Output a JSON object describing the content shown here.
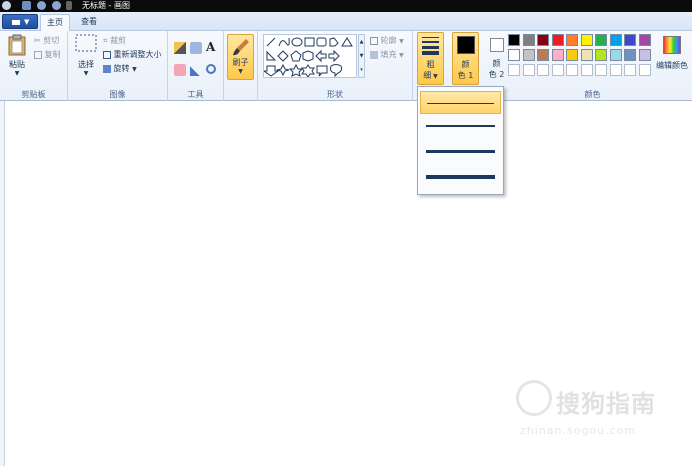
{
  "window": {
    "title": "无标题 - 画图"
  },
  "tabs": [
    {
      "label": "主页",
      "active": true
    },
    {
      "label": "查看",
      "active": false
    }
  ],
  "groups": {
    "clipboard": {
      "name": "剪贴板",
      "paste": "粘贴",
      "cut": "剪切",
      "copy": "复制"
    },
    "image": {
      "name": "图像",
      "select": "选择",
      "crop": "裁剪",
      "resize": "重新调整大小",
      "rotate": "旋转"
    },
    "tools": {
      "name": "工具"
    },
    "brush": {
      "label": "刷子"
    },
    "shapes": {
      "name": "形状",
      "outline": "轮廓",
      "fill": "填充"
    },
    "size": {
      "label_line1": "粗",
      "label_line2": "细"
    },
    "colors": {
      "name": "颜色",
      "color1_line1": "颜",
      "color1_line2": "色 1",
      "color2_line1": "颜",
      "color2_line2": "色 2",
      "edit": "编辑颜色",
      "palette_row1": [
        "#000000",
        "#7f7f7f",
        "#880015",
        "#ed1c24",
        "#ff7f27",
        "#fff200",
        "#22b14c",
        "#00a2e8",
        "#3f48cc",
        "#a349a4"
      ],
      "palette_row2": [
        "#ffffff",
        "#c3c3c3",
        "#b97a57",
        "#ffaec9",
        "#ffc90e",
        "#efe4b0",
        "#b5e61d",
        "#99d9ea",
        "#7092be",
        "#c8bfe7"
      ],
      "color1": "#000000",
      "color2": "#ffffff"
    }
  },
  "size_dropdown": {
    "options": [
      {
        "name": "1px",
        "selected": true
      },
      {
        "name": "3px",
        "selected": false
      },
      {
        "name": "5px",
        "selected": false
      },
      {
        "name": "8px",
        "selected": false
      }
    ]
  },
  "watermark": {
    "text": "搜狗指南",
    "url": "zhinan.sogou.com"
  }
}
